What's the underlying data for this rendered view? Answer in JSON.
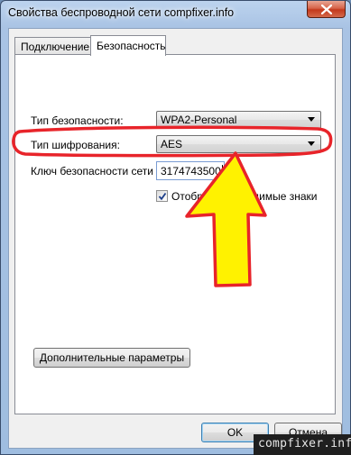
{
  "window": {
    "title": "Свойства беспроводной сети compfixer.info"
  },
  "tabs": [
    {
      "label": "Подключение",
      "active": false
    },
    {
      "label": "Безопасность",
      "active": true
    }
  ],
  "security": {
    "type_label": "Тип безопасности:",
    "type_value": "WPA2-Personal",
    "encryption_label": "Тип шифрования:",
    "encryption_value": "AES",
    "key_label": "Ключ безопасности сети",
    "key_value": "3174743500",
    "show_chars_label": "Отображать вводимые знаки",
    "show_chars_checked": true
  },
  "advanced_button": "Дополнительные параметры",
  "footer": {
    "ok_label": "OK",
    "cancel_label": "Отмена"
  },
  "annotation": {
    "highlight_color": "#e8242a",
    "arrow_fill": "#fff200",
    "arrow_stroke": "#e8242a"
  },
  "watermark": "compfixer.info"
}
